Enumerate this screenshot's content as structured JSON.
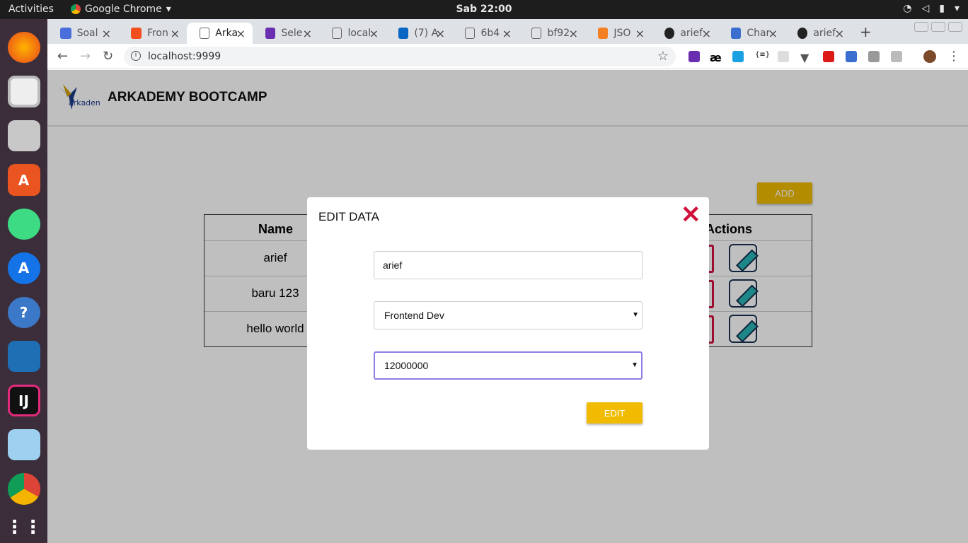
{
  "os": {
    "activities": "Activities",
    "app_name": "Google Chrome",
    "clock": "Sab 22:00"
  },
  "browser": {
    "tabs": [
      {
        "label": "Soal",
        "color": "#4a6fdc"
      },
      {
        "label": "Fron",
        "color": "#f24e1e"
      },
      {
        "label": "Arka",
        "color": "#ffffff"
      },
      {
        "label": "Sele",
        "color": "#6a2fb0"
      },
      {
        "label": "local",
        "color": "#ffffff"
      },
      {
        "label": "(7) A",
        "color": "#0a66c2"
      },
      {
        "label": "6b4",
        "color": "#ffffff"
      },
      {
        "label": "bf92",
        "color": "#ffffff"
      },
      {
        "label": "JSO",
        "color": "#f48024"
      },
      {
        "label": "arief",
        "color": "#222222"
      },
      {
        "label": "Char",
        "color": "#3a6fd0"
      },
      {
        "label": "arief",
        "color": "#222222"
      }
    ],
    "url": "localhost:9999"
  },
  "app": {
    "brand": "ARKADEMY BOOTCAMP",
    "add_label": "ADD",
    "table": {
      "headers": {
        "name": "Name",
        "actions": "Actions"
      },
      "rows": [
        {
          "name": "arief"
        },
        {
          "name": "baru 123"
        },
        {
          "name": "hello world"
        }
      ]
    }
  },
  "modal": {
    "title": "EDIT DATA",
    "close_glyph": "✕",
    "name_value": "arief",
    "role_value": "Frontend Dev",
    "salary_value": "12000000",
    "submit_label": "EDIT"
  },
  "colors": {
    "accent": "#f0bb00",
    "close": "#d0103a",
    "focus": "#8b7ee6"
  }
}
